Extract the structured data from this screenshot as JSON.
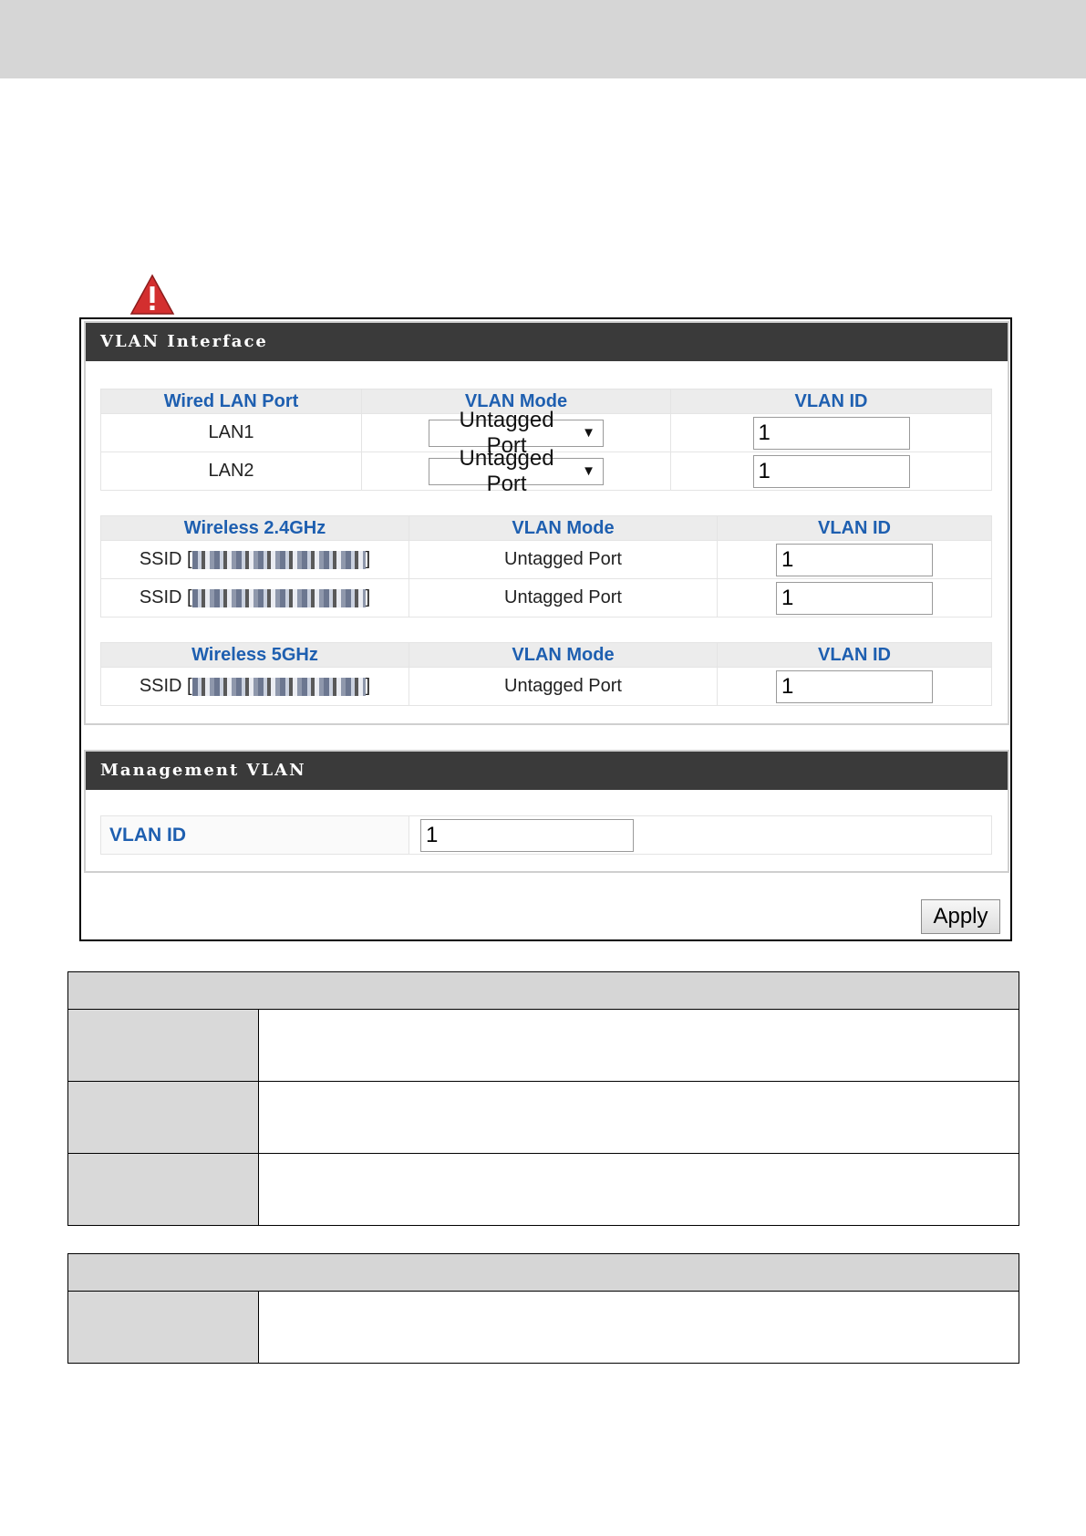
{
  "vlan_interface": {
    "title": "VLAN Interface",
    "wired": {
      "headers": [
        "Wired LAN Port",
        "VLAN Mode",
        "VLAN ID"
      ],
      "rows": [
        {
          "port": "LAN1",
          "mode": "Untagged Port",
          "vlan_id": "1"
        },
        {
          "port": "LAN2",
          "mode": "Untagged Port",
          "vlan_id": "1"
        }
      ]
    },
    "wireless_24": {
      "headers": [
        "Wireless 2.4GHz",
        "VLAN Mode",
        "VLAN ID"
      ],
      "rows": [
        {
          "ssid_prefix": "SSID [",
          "ssid_suffix": "]",
          "mode": "Untagged Port",
          "vlan_id": "1"
        },
        {
          "ssid_prefix": "SSID [",
          "ssid_suffix": "]",
          "mode": "Untagged Port",
          "vlan_id": "1"
        }
      ]
    },
    "wireless_5": {
      "headers": [
        "Wireless 5GHz",
        "VLAN Mode",
        "VLAN ID"
      ],
      "rows": [
        {
          "ssid_prefix": "SSID [",
          "ssid_suffix": "]",
          "mode": "Untagged Port",
          "vlan_id": "1"
        }
      ]
    }
  },
  "management_vlan": {
    "title": "Management VLAN",
    "label": "VLAN ID",
    "vlan_id": "1"
  },
  "apply_label": "Apply",
  "icons": {
    "warning": "warning-triangle-icon",
    "dropdown": "chevron-down-icon"
  },
  "colors": {
    "header_bar": "#3a3a3a",
    "column_header_text": "#1e5fb0",
    "top_band": "#d6d6d6",
    "warning": "#d32f2f"
  }
}
